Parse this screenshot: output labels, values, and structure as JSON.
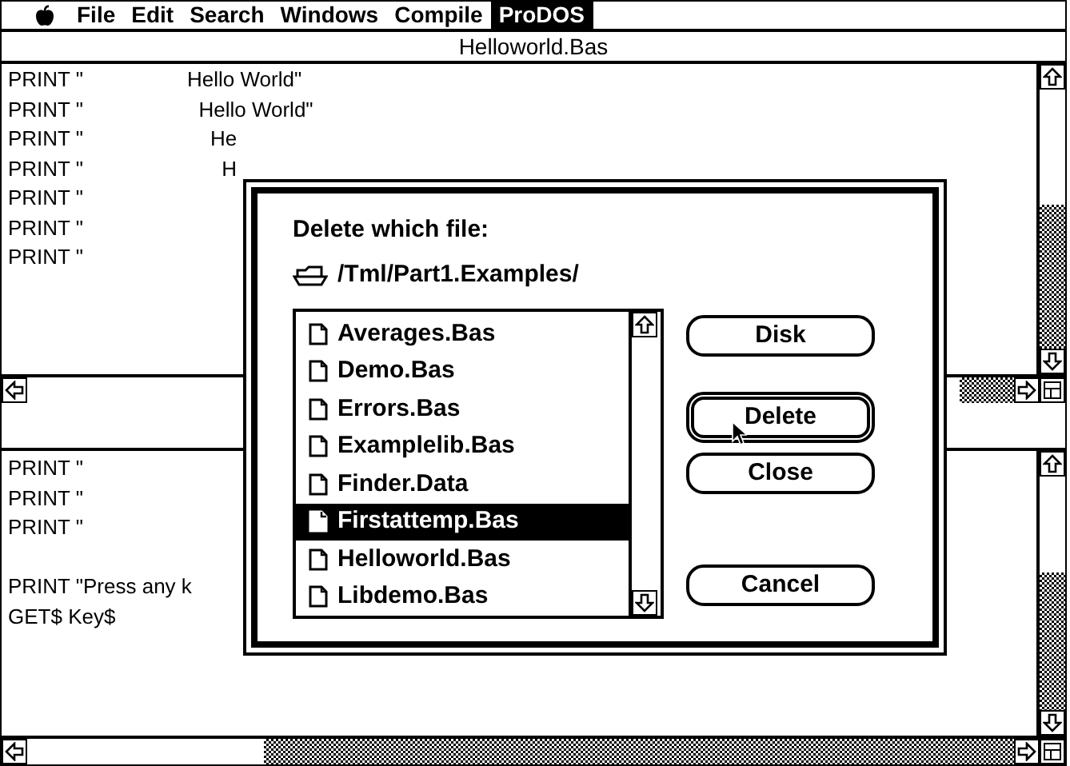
{
  "menu_bar": {
    "items": [
      {
        "label": "File",
        "selected": false
      },
      {
        "label": "Edit",
        "selected": false
      },
      {
        "label": "Search",
        "selected": false
      },
      {
        "label": "Windows",
        "selected": false
      },
      {
        "label": "Compile",
        "selected": false
      },
      {
        "label": "ProDOS",
        "selected": true
      }
    ]
  },
  "editor_top": {
    "title": "Helloworld.Bas",
    "lines": [
      "PRINT \"                  Hello World\"",
      "PRINT \"                    Hello World\"",
      "PRINT \"                      He",
      "PRINT \"                        H",
      "PRINT \"",
      "PRINT \"",
      "PRINT \""
    ]
  },
  "editor_bottom": {
    "blocks": [
      [
        "PRINT \"",
        "PRINT \"",
        "PRINT \""
      ],
      [
        "PRINT \"Press any k",
        "GET$ Key$"
      ]
    ]
  },
  "dialog": {
    "prompt": "Delete which file:",
    "path": "/Tml/Part1.Examples/",
    "files": [
      {
        "name": "Averages.Bas",
        "selected": false
      },
      {
        "name": "Demo.Bas",
        "selected": false
      },
      {
        "name": "Errors.Bas",
        "selected": false
      },
      {
        "name": "Examplelib.Bas",
        "selected": false
      },
      {
        "name": "Finder.Data",
        "selected": false
      },
      {
        "name": "Firstattemp.Bas",
        "selected": true
      },
      {
        "name": "Helloworld.Bas",
        "selected": false
      },
      {
        "name": "Libdemo.Bas",
        "selected": false
      }
    ],
    "buttons": [
      {
        "label": "Disk",
        "default": false
      },
      {
        "label": "Delete",
        "default": true
      },
      {
        "label": "Close",
        "default": false
      },
      {
        "label": "Cancel",
        "default": false
      }
    ]
  }
}
